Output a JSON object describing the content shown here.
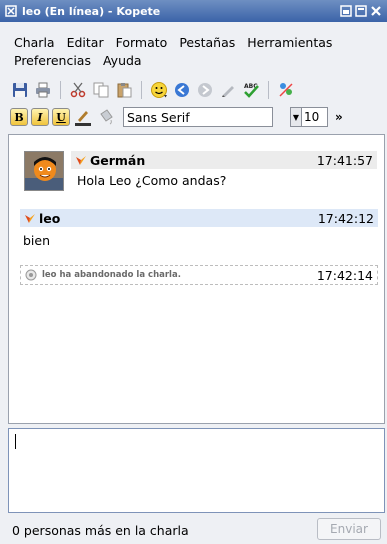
{
  "window": {
    "title": "leo (En línea) - Kopete"
  },
  "menubar": {
    "row1": [
      "Charla",
      "Editar",
      "Formato",
      "Pestañas",
      "Herramientas"
    ],
    "row2": [
      "Preferencias",
      "Ayuda"
    ]
  },
  "toolbar": {
    "font_family": "Sans Serif",
    "font_size": "10",
    "more": "»"
  },
  "messages": [
    {
      "sender": "Germán",
      "time": "17:41:57",
      "text": "Hola Leo ¿Como andas?"
    },
    {
      "sender": "leo",
      "time": "17:42:12",
      "text": "bien"
    }
  ],
  "system_message": {
    "text": "leo ha abandonado la charla.",
    "time": "17:42:14"
  },
  "status": {
    "text": "0 personas más en la charla",
    "send_label": "Enviar"
  },
  "colors": {
    "titlebar": "#3b63a8",
    "own_message_header": "#dde8f7",
    "other_message_header": "#ececec"
  }
}
